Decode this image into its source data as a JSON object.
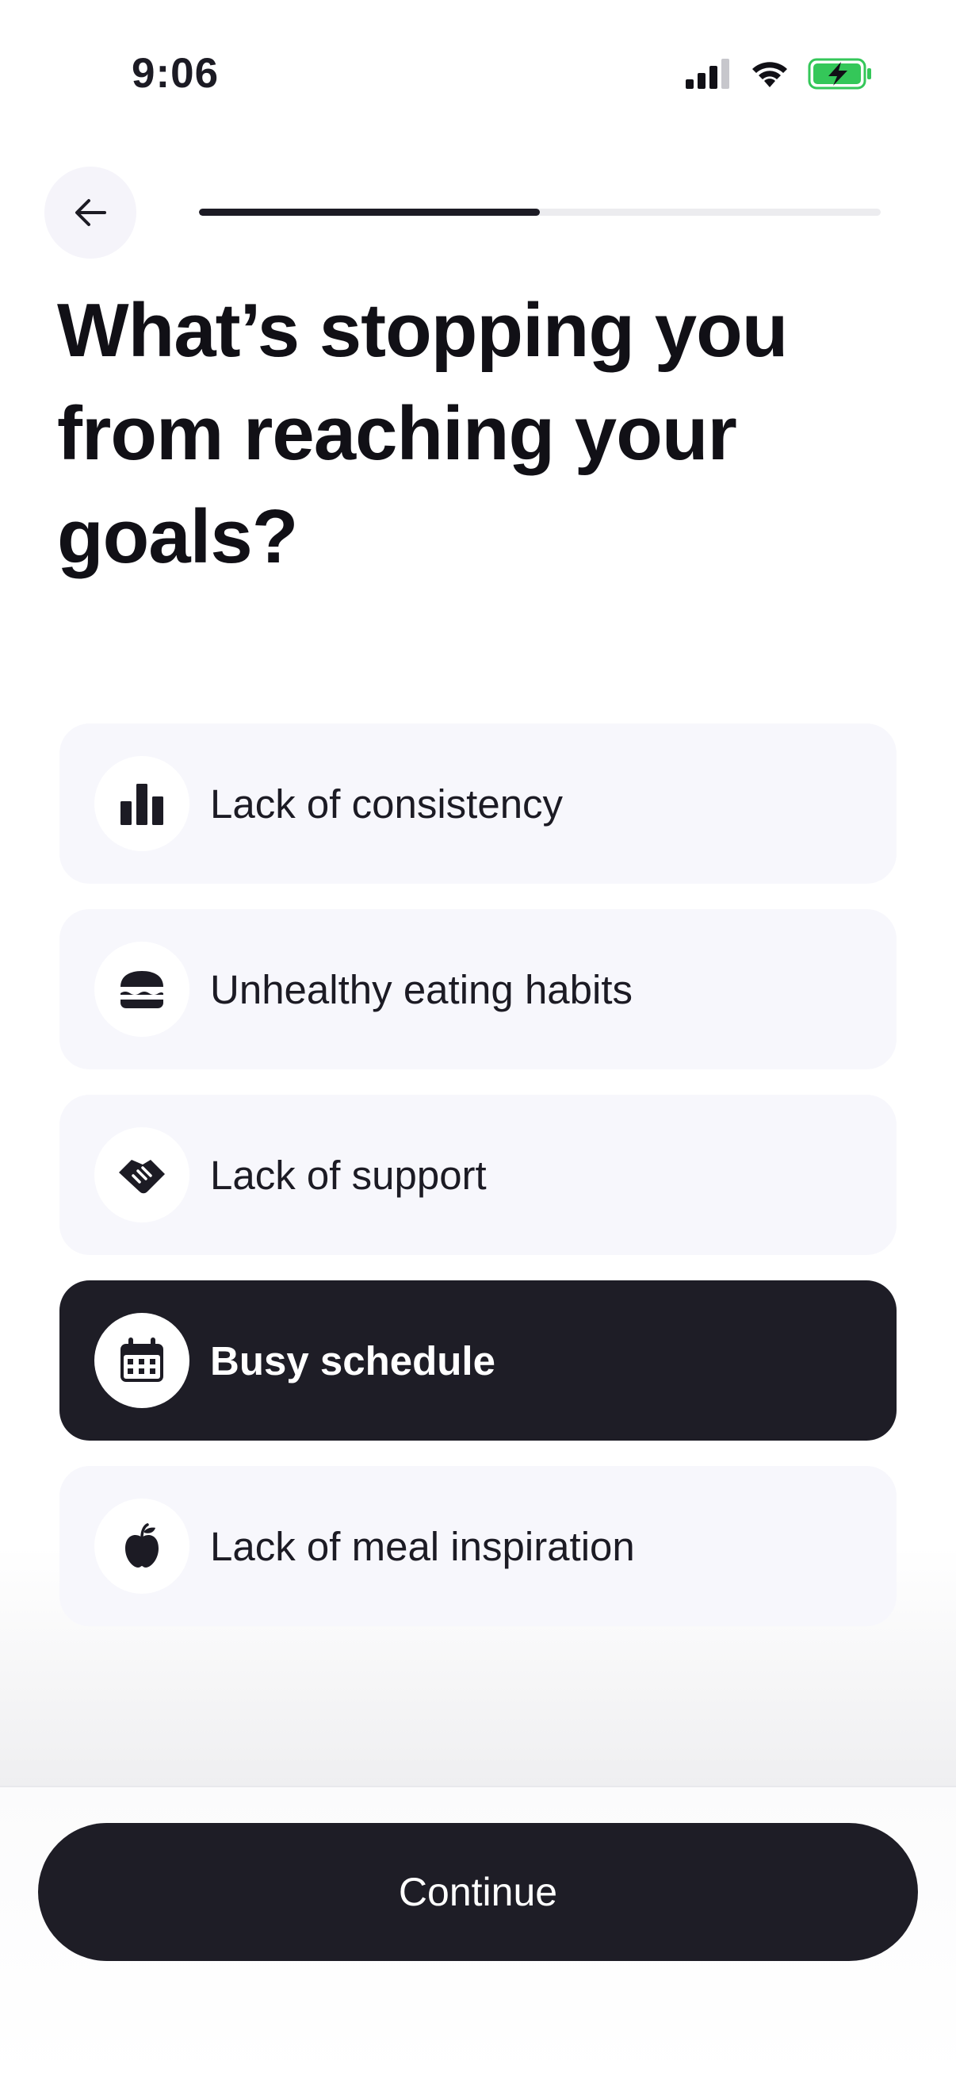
{
  "status_bar": {
    "time": "9:06",
    "icons": [
      "cellular-signal-icon",
      "wifi-icon",
      "battery-charging-icon"
    ],
    "battery_color": "#34c759"
  },
  "header": {
    "back_icon": "arrow-left-icon",
    "progress": 0.5
  },
  "title": "What’s stopping you from reaching your goals?",
  "options": [
    {
      "label": "Lack of consistency",
      "icon": "bar-chart-icon",
      "selected": false
    },
    {
      "label": "Unhealthy eating habits",
      "icon": "burger-icon",
      "selected": false
    },
    {
      "label": "Lack of support",
      "icon": "handshake-icon",
      "selected": false
    },
    {
      "label": "Busy schedule",
      "icon": "calendar-icon",
      "selected": true
    },
    {
      "label": "Lack of meal inspiration",
      "icon": "apple-icon",
      "selected": false
    }
  ],
  "footer": {
    "continue_label": "Continue"
  },
  "colors": {
    "primary_dark": "#1e1d26",
    "option_bg": "#f7f7fc",
    "text": "#1c1b24"
  }
}
